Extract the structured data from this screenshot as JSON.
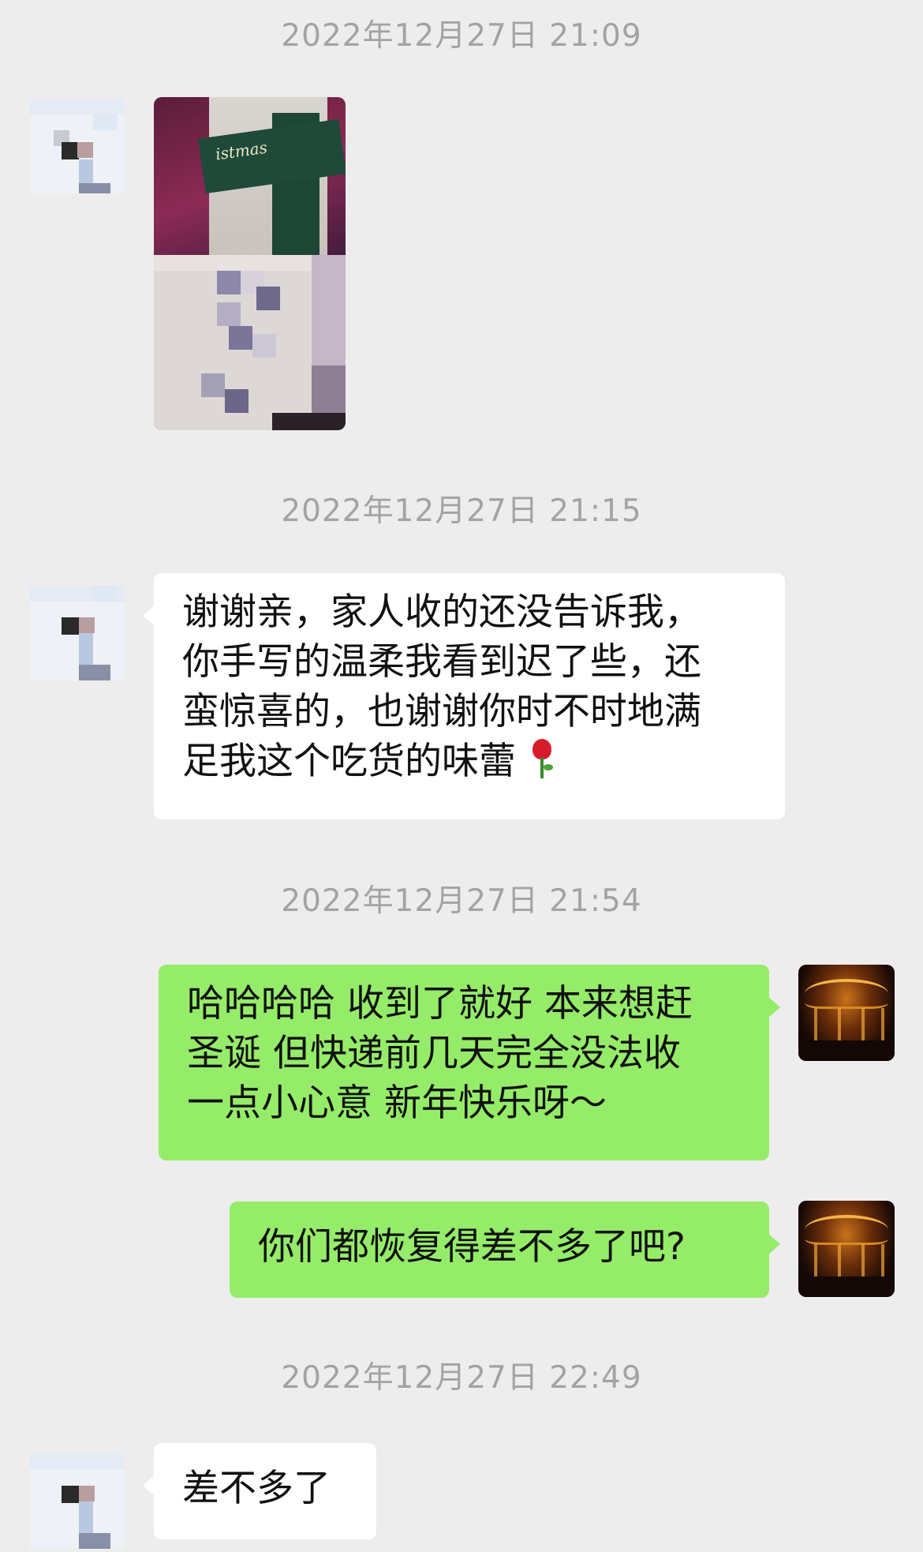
{
  "messages": [
    {
      "timestamp": "2022年12月27日 21:09",
      "sender": "other",
      "type": "image",
      "image_label": "istmas"
    },
    {
      "timestamp": "2022年12月27日 21:15",
      "sender": "other",
      "type": "text",
      "lines": [
        "谢谢亲，家人收的还没告诉我，",
        "你手写的温柔我看到迟了些，还",
        "蛮惊喜的，也谢谢你时不时地满",
        "足我这个吃货的味蕾"
      ],
      "emoji": "rose"
    },
    {
      "timestamp": "2022年12月27日 21:54",
      "sender": "me",
      "type": "text",
      "lines": [
        "哈哈哈哈 收到了就好 本来想赶",
        "圣诞 但快递前几天完全没法收",
        "一点小心意 新年快乐呀～"
      ]
    },
    {
      "sender": "me",
      "type": "text",
      "lines": [
        "你们都恢复得差不多了吧?"
      ]
    },
    {
      "timestamp": "2022年12月27日 22:49",
      "sender": "other",
      "type": "text",
      "lines": [
        "差不多了"
      ]
    }
  ],
  "colors": {
    "background": "#ededed",
    "bubble_other": "#ffffff",
    "bubble_me": "#95ec69",
    "timestamp": "#a3a3a3"
  },
  "icons": {
    "rose_emoji": "rose-icon"
  }
}
